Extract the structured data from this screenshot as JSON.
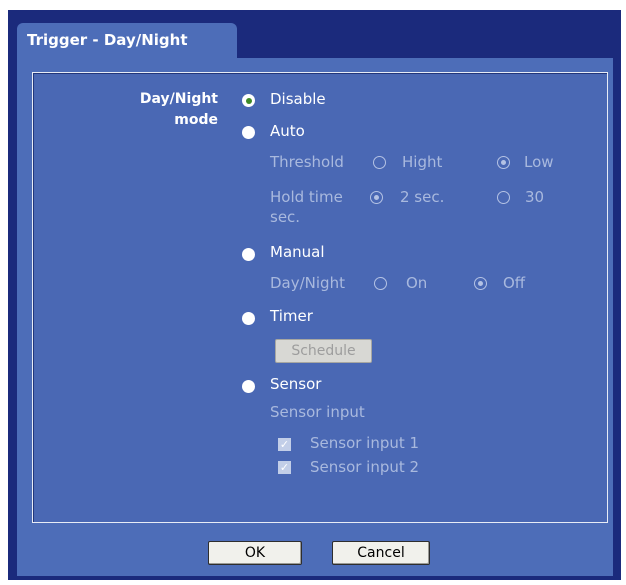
{
  "tab_title": "Trigger - Day/Night",
  "mode_label_line1": "Day/Night",
  "mode_label_line2": "mode",
  "options": {
    "disable": "Disable",
    "auto": "Auto",
    "manual": "Manual",
    "timer": "Timer",
    "sensor": "Sensor"
  },
  "selected_mode": "Disable",
  "auto_settings": {
    "threshold_label": "Threshold",
    "threshold_high": "Hight",
    "threshold_low": "Low",
    "threshold_selected": "Low",
    "hold_time_label": "Hold time",
    "hold_2": "2 sec.",
    "hold_30": "30",
    "hold_30_unit": "sec.",
    "hold_selected": "2 sec."
  },
  "manual_settings": {
    "label": "Day/Night",
    "on": "On",
    "off": "Off",
    "selected": "Off"
  },
  "timer_settings": {
    "schedule_button": "Schedule"
  },
  "sensor_settings": {
    "label": "Sensor input",
    "input1": "Sensor input 1",
    "input1_checked": true,
    "input2": "Sensor input 2",
    "input2_checked": true
  },
  "buttons": {
    "ok": "OK",
    "cancel": "Cancel"
  }
}
